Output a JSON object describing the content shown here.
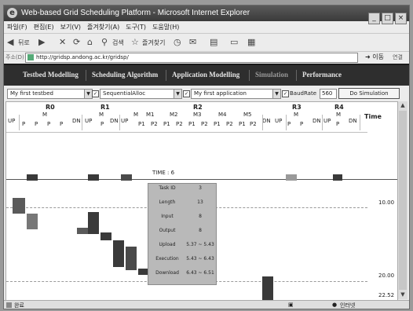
{
  "window": {
    "title": "Web-based Grid Scheduling Platform - Microsoft Internet Explorer",
    "controls": [
      "_",
      "□",
      "×"
    ]
  },
  "menu": [
    "파일(F)",
    "편집(E)",
    "보기(V)",
    "즐겨찾기(A)",
    "도구(T)",
    "도움말(H)"
  ],
  "toolbar": {
    "back_label": "뒤로",
    "search_label": "검색",
    "favorites_label": "즐겨찾기"
  },
  "address": {
    "label": "주소(D)",
    "url": "http://gridsp.andong.ac.kr/gridsp/",
    "go_label": "이동",
    "links_label": "연결"
  },
  "nav": {
    "items": [
      {
        "label": "Testbed Modelling"
      },
      {
        "label": "Scheduling Algorithm"
      },
      {
        "label": "Application Modelling"
      },
      {
        "label": "Simulation",
        "active": true
      },
      {
        "label": "Performance"
      }
    ]
  },
  "controls": {
    "testbed": "My first testbed",
    "algorithm": "SequentialAlloc",
    "application": "My first application",
    "baudrate_label": "BaudRate",
    "baudrate_value": "560",
    "simulate_label": "Do Simulation"
  },
  "chart": {
    "resources": [
      "R0",
      "R1",
      "R2",
      "R3",
      "R4"
    ],
    "time_header": "Time",
    "time_marker": "TIME : 6",
    "time_labels": [
      "10.00",
      "20.00",
      "22.52"
    ]
  },
  "popup": {
    "rows": [
      {
        "key": "Task ID",
        "value": "3"
      },
      {
        "key": "Length",
        "value": "13"
      },
      {
        "key": "Input",
        "value": "8"
      },
      {
        "key": "Output",
        "value": "8"
      },
      {
        "key": "Upload",
        "value": "5.37 ~ 5.43"
      },
      {
        "key": "Execution",
        "value": "5.43 ~ 6.43"
      },
      {
        "key": "Download",
        "value": "6.43 ~ 6.51"
      }
    ]
  },
  "status": {
    "left": "완료",
    "right": "인터넷"
  },
  "colors": {
    "nav_bg": "#2e2e2e",
    "bar_dark": "#3a3a3a",
    "bar_mid": "#777777",
    "popup_bg": "#b9b9b9"
  }
}
